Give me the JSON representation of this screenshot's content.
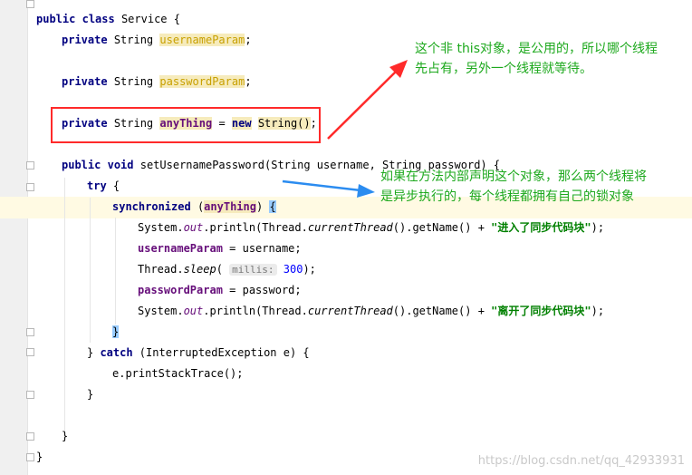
{
  "code": {
    "class_decl": {
      "kw1": "public",
      "kw2": "class",
      "name": "Service",
      "brace": "{"
    },
    "field1": {
      "kw": "private",
      "type": "String",
      "name": "usernameParam",
      "end": ";"
    },
    "field2": {
      "kw": "private",
      "type": "String",
      "name": "passwordParam",
      "end": ";"
    },
    "field3": {
      "kw": "private",
      "type": "String",
      "name": "anyThing",
      "eq": "=",
      "kw_new": "new",
      "ctor": "String()",
      "end": ";"
    },
    "method": {
      "kw1": "public",
      "kw2": "void",
      "sig": "setUsernamePassword(String username, String password) {"
    },
    "try": {
      "kw": "try",
      "brace": "{"
    },
    "sync": {
      "kw": "synchronized",
      "open": "(",
      "arg": "anyThing",
      "close": ")",
      "brace": "{"
    },
    "print1": {
      "pre": "System.",
      "out": "out",
      "mid": ".println(Thread.",
      "ct": "currentThread",
      "post": "().getName() + ",
      "str": "\"进入了同步代码块\"",
      "end": ");"
    },
    "assign1": {
      "field": "usernameParam",
      "rest": " = username;"
    },
    "sleep": {
      "pre": "Thread.",
      "method": "sleep",
      "open": "(",
      "hint": "millis:",
      "num": "300",
      "end": ");"
    },
    "assign2": {
      "field": "passwordParam",
      "rest": " = password;"
    },
    "print2": {
      "pre": "System.",
      "out": "out",
      "mid": ".println(Thread.",
      "ct": "currentThread",
      "post": "().getName() + ",
      "str": "\"离开了同步代码块\"",
      "end": ");"
    },
    "sync_close": "}",
    "catch": {
      "pre": "} ",
      "kw": "catch",
      "rest": " (InterruptedException e) {"
    },
    "stack": "e.printStackTrace();",
    "catch_close": "}",
    "method_close": "}",
    "class_close": "}"
  },
  "notes": {
    "top_line1": "这个非 this对象，是公用的，所以哪个线程",
    "top_line2": "先占有，另外一个线程就等待。",
    "mid_line1": "如果在方法内部声明这个对象，那么两个线程将",
    "mid_line2": "是异步执行的，每个线程都拥有自己的锁对象"
  },
  "watermark": "https://blog.csdn.net/qq_42933931",
  "colors": {
    "annotation_box": "#ff2a2a",
    "red_arrow": "#ff2a2a",
    "blue_arrow": "#2b8cf0",
    "note_text": "#1ea91e"
  }
}
